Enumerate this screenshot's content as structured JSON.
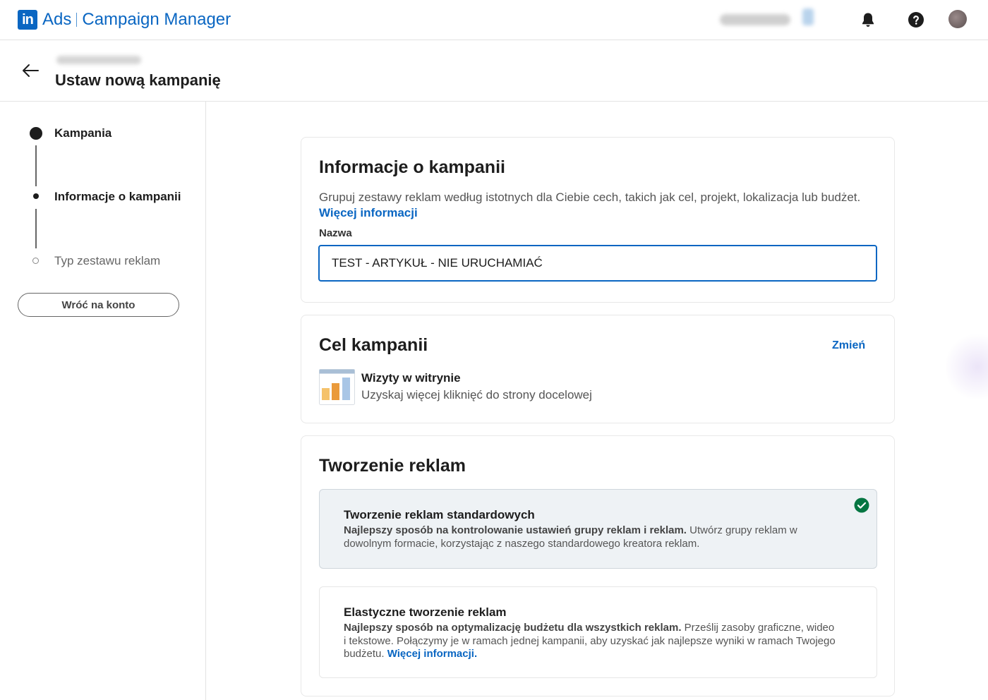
{
  "header": {
    "brand_ads": "Ads",
    "brand_product": "Campaign Manager",
    "logo_text": "in"
  },
  "subheader": {
    "page_title": "Ustaw nową kampanię"
  },
  "steps": [
    {
      "label": "Kampania",
      "state": "complete"
    },
    {
      "label": "Informacje o kampanii",
      "state": "current"
    },
    {
      "label": "Typ zestawu reklam",
      "state": "upcoming"
    }
  ],
  "rail": {
    "back_to_account": "Wróć na konto"
  },
  "campaign_info": {
    "title": "Informacje o kampanii",
    "description": "Grupuj zestawy reklam według istotnych dla Ciebie cech, takich jak cel, projekt, lokalizacja lub budżet.",
    "more_link": "Więcej informacji",
    "name_label": "Nazwa",
    "name_value": "TEST - ARTYKUŁ - NIE URUCHAMIAĆ"
  },
  "campaign_goal": {
    "title": "Cel kampanii",
    "change_link": "Zmień",
    "goal_title": "Wizyty w witrynie",
    "goal_desc": "Uzyskaj więcej kliknięć do strony docelowej"
  },
  "ad_creation": {
    "title": "Tworzenie reklam",
    "options": [
      {
        "title": "Tworzenie reklam standardowych",
        "bold": "Najlepszy sposób na kontrolowanie ustawień grupy reklam i reklam.",
        "text": " Utwórz grupy reklam w dowolnym formacie, korzystając z naszego standardowego kreatora reklam.",
        "selected": true
      },
      {
        "title": "Elastyczne tworzenie reklam",
        "bold": "Najlepszy sposób na optymalizację budżetu dla wszystkich reklam.",
        "text": " Prześlij zasoby graficzne, wideo i tekstowe. Połączymy je w ramach jednej kampanii, aby uzyskać jak najlepsze wyniki w ramach Twojego budżetu.",
        "link": "Więcej informacji.",
        "selected": false
      }
    ]
  },
  "colors": {
    "brand_blue": "#0a66c2",
    "check_green": "#057642"
  }
}
